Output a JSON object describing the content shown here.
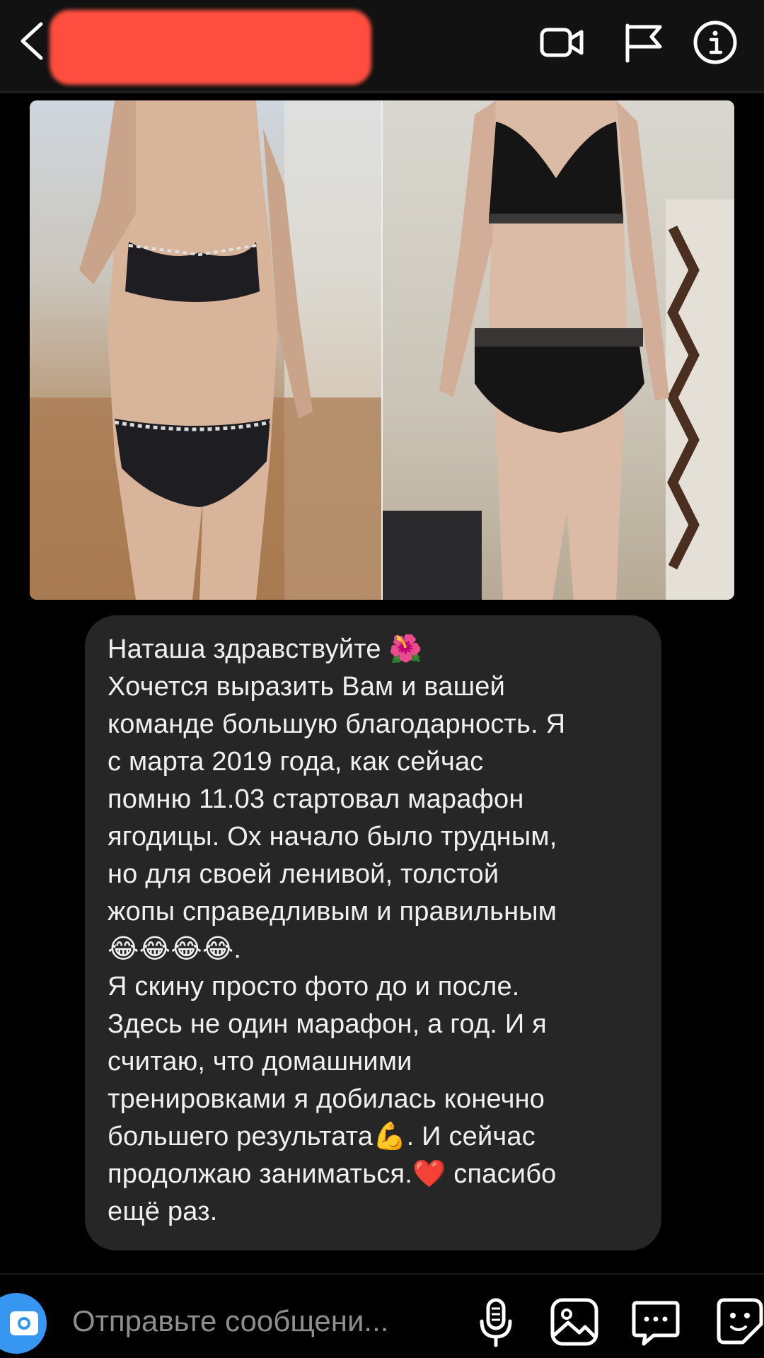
{
  "header": {
    "contact_name": "",
    "back_icon": "chevron-left-icon",
    "video_icon": "video-camera-icon",
    "flag_icon": "flag-icon",
    "info_icon": "info-icon",
    "redact_color": "#ff4e3f"
  },
  "photo": {
    "description_icon": "image-icon"
  },
  "message": {
    "text": "Наташа здравствуйте 🌺\nХочется выразить Вам и вашей\nкоманде большую благодарность. Я\nс марта 2019 года, как сейчас\nпомню 11.03 стартовал марафон\nягодицы. Ох начало было трудным,\nно для своей ленивой, толстой\nжопы справедливым и правильным\n😂😂😂😂.\nЯ скину просто фото до и после.\nЗдесь не один марафон, а год. И я\nсчитаю, что домашними\nтренировками я добилась конечно\nбольшего результата💪. И сейчас\nпродолжаю заниматься.❤️ спасибо\nещё раз.",
    "bubble_color": "#262626"
  },
  "composer": {
    "placeholder": "Отправьте сообщени...",
    "camera_color": "#3797f0"
  }
}
